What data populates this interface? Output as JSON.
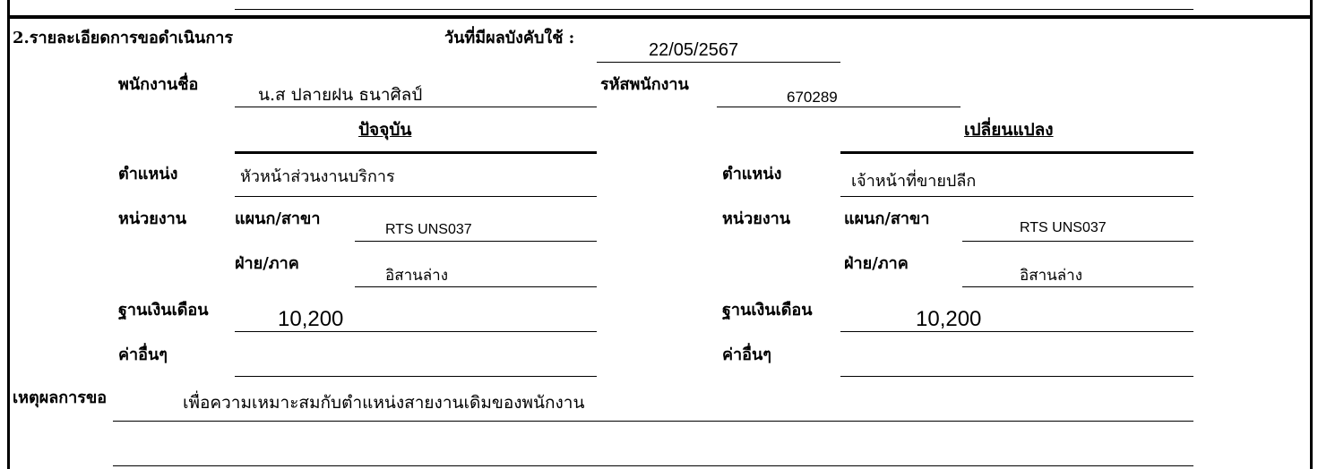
{
  "section1": {
    "label_fragment": ""
  },
  "section2": {
    "title": "2.รายละเอียดการขอดำเนินการ",
    "effective_date_label": "วันที่มีผลบังคับใช้ :",
    "effective_date": "22/05/2567",
    "employee_name_label": "พนักงานชื่อ",
    "employee_name": "น.ส ปลายฝน ธนาศิลป์",
    "employee_id_label": "รหัสพนักงาน",
    "employee_id": "670289"
  },
  "current": {
    "heading": "ปัจจุบัน",
    "position_label": "ตำแหน่ง",
    "position": "หัวหน้าส่วนงานบริการ",
    "unit_label": "หน่วยงาน",
    "dept_label": "แผนก/สาขา",
    "dept": "RTS UNS037",
    "division_label": "ฝ่าย/ภาค",
    "division": "อิสานล่าง",
    "salary_label": "ฐานเงินเดือน",
    "salary": "10,200",
    "other_label": "ค่าอื่นๆ",
    "other": ""
  },
  "change": {
    "heading": "เปลี่ยนแปลง",
    "position_label": "ตำแหน่ง",
    "position": "เจ้าหน้าที่ขายปลีก",
    "unit_label": "หน่วยงาน",
    "dept_label": "แผนก/สาขา",
    "dept": "RTS UNS037",
    "division_label": "ฝ่าย/ภาค",
    "division": "อิสานล่าง",
    "salary_label": "ฐานเงินเดือน",
    "salary": "10,200",
    "other_label": "ค่าอื่นๆ",
    "other": ""
  },
  "reason": {
    "label": "เหตุผลการขอ",
    "text": "เพื่อความเหมาะสมกับตำแหน่งสายงานเดิมของพนักงาน"
  }
}
